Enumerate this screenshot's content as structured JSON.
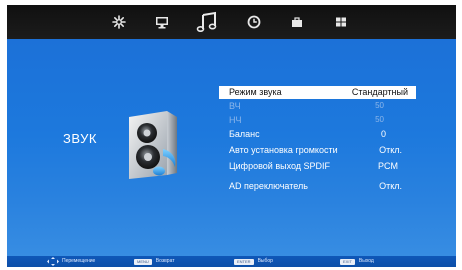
{
  "topbar": {
    "tabs": [
      {
        "name": "picture",
        "icon": "asterisk-icon"
      },
      {
        "name": "screen",
        "icon": "monitor-icon"
      },
      {
        "name": "sound",
        "icon": "music-note-icon",
        "active": true
      },
      {
        "name": "time",
        "icon": "clock-icon"
      },
      {
        "name": "lock",
        "icon": "briefcase-icon"
      },
      {
        "name": "setup",
        "icon": "grid-icon"
      }
    ]
  },
  "section": {
    "title": "ЗВУК",
    "icon": "speaker-music-icon"
  },
  "menu": {
    "items": [
      {
        "label": "Режим звука",
        "value": "Стандартный",
        "selected": true
      },
      {
        "label": "ВЧ",
        "value": "50",
        "disabled": true
      },
      {
        "label": "НЧ",
        "value": "50",
        "disabled": true
      },
      {
        "label": "Баланс",
        "value": "0"
      },
      {
        "label": "Авто установка громкости",
        "value": "Откл."
      },
      {
        "label": "Цифровой выход SPDIF",
        "value": "PCM"
      },
      {
        "label": "AD переключатель",
        "value": "Откл."
      }
    ]
  },
  "bottombar": {
    "move": {
      "icon": "dpad-icon",
      "label": "Перемещение"
    },
    "back": {
      "key": "MENU",
      "label": "Возврат"
    },
    "select": {
      "key": "ENTER",
      "label": "Выбор"
    },
    "exit": {
      "key": "EXIT",
      "label": "Выход"
    }
  },
  "colors": {
    "background": "#1b6ed6",
    "topbar": "#141414",
    "selected_row": "#ffffff"
  }
}
